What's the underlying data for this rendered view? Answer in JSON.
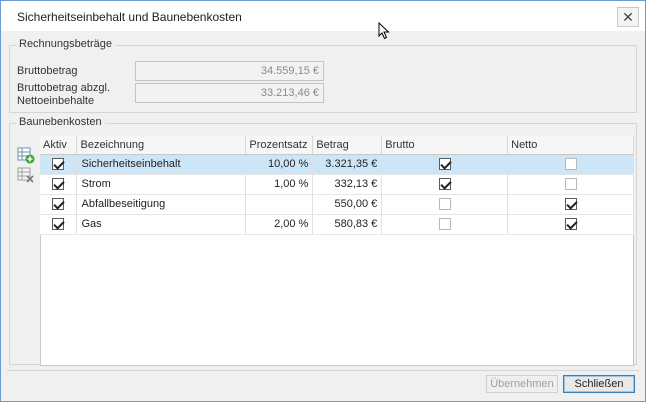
{
  "window": {
    "title": "Sicherheitseinbehalt und Baunebenkosten",
    "close_glyph": "✕"
  },
  "rechnungsbetraege": {
    "title": "Rechnungsbeträge",
    "brutto_label": "Bruttobetrag",
    "brutto_value": "34.559,15 €",
    "netto_label_1": "Bruttobetrag abzgl.",
    "netto_label_2": "Nettoeinbehalte",
    "netto_value": "33.213,46 €"
  },
  "baunebenkosten": {
    "title": "Baunebenkosten",
    "columns": {
      "aktiv": "Aktiv",
      "bezeichnung": "Bezeichnung",
      "prozentsatz": "Prozentsatz",
      "betrag": "Betrag",
      "brutto": "Brutto",
      "netto": "Netto"
    },
    "rows": [
      {
        "aktiv": true,
        "bezeichnung": "Sicherheitseinbehalt",
        "prozentsatz": "10,00 %",
        "betrag": "3.321,35 €",
        "brutto": true,
        "netto": false,
        "selected": true
      },
      {
        "aktiv": true,
        "bezeichnung": "Strom",
        "prozentsatz": "1,00 %",
        "betrag": "332,13 €",
        "brutto": true,
        "netto": false,
        "selected": false
      },
      {
        "aktiv": true,
        "bezeichnung": "Abfallbeseitigung",
        "prozentsatz": "",
        "betrag": "550,00 €",
        "brutto": false,
        "netto": true,
        "selected": false
      },
      {
        "aktiv": true,
        "bezeichnung": "Gas",
        "prozentsatz": "2,00 %",
        "betrag": "580,83 €",
        "brutto": false,
        "netto": true,
        "selected": false
      }
    ]
  },
  "footer": {
    "apply_label": "Übernehmen",
    "close_label": "Schließen"
  }
}
